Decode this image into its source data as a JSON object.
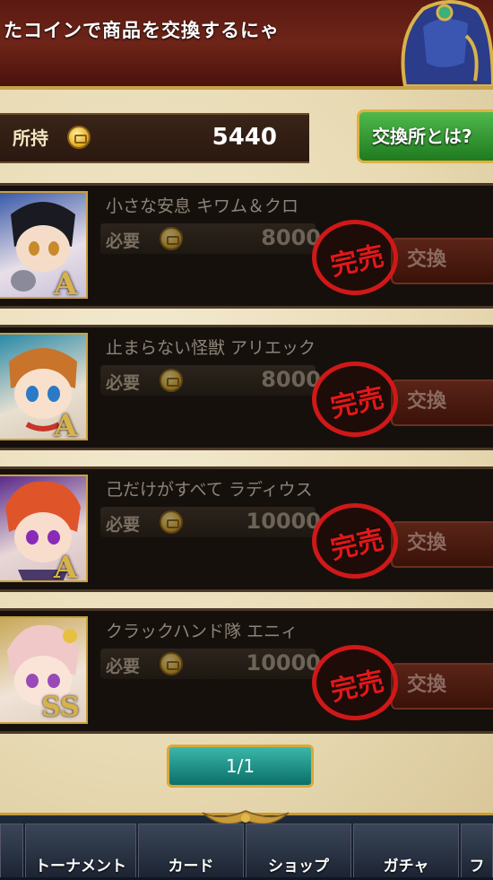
{
  "banner": {
    "message": "たコインで商品を交換するにゃ"
  },
  "coins": {
    "label": "所持",
    "value": "5440"
  },
  "about_button": {
    "label": "交換所とは?"
  },
  "items": [
    {
      "name": "小さな安息 キワム＆クロ",
      "required_label": "必要",
      "cost": "8000",
      "rank": "A",
      "sold_label": "完売",
      "exchange_label": "交換"
    },
    {
      "name": "止まらない怪獣 アリエック",
      "required_label": "必要",
      "cost": "8000",
      "rank": "A",
      "sold_label": "完売",
      "exchange_label": "交換"
    },
    {
      "name": "己だけがすべて ラディウス",
      "required_label": "必要",
      "cost": "10000",
      "rank": "A",
      "sold_label": "完売",
      "exchange_label": "交換"
    },
    {
      "name": "クラックハンド隊 エニィ",
      "required_label": "必要",
      "cost": "10000",
      "rank": "SS",
      "sold_label": "完売",
      "exchange_label": "交換"
    }
  ],
  "pager": {
    "label": "1/1"
  },
  "nav": {
    "tabs": [
      {
        "label": "トーナメント"
      },
      {
        "label": "カード"
      },
      {
        "label": "ショップ"
      },
      {
        "label": "ガチャ"
      },
      {
        "label": "フ"
      }
    ]
  },
  "colors": {
    "sold_stamp": "#d01818",
    "pager": "#1a9a8e",
    "about_button": "#2e9a2e",
    "gold_trim": "#d8a83a"
  }
}
